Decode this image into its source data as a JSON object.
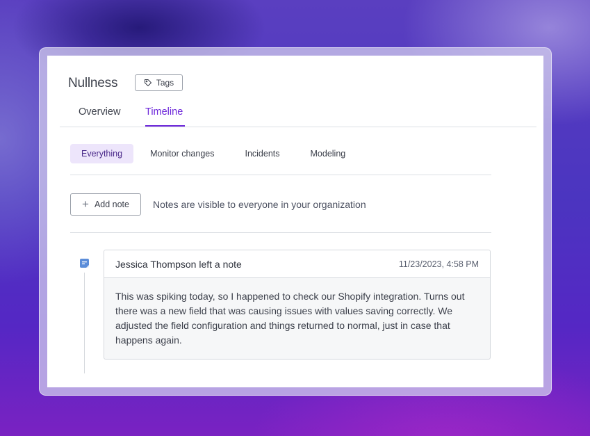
{
  "page": {
    "title": "Nullness",
    "tags_label": "Tags"
  },
  "tabs": [
    {
      "label": "Overview",
      "active": false
    },
    {
      "label": "Timeline",
      "active": true
    }
  ],
  "filters": [
    {
      "label": "Everything",
      "active": true
    },
    {
      "label": "Monitor changes",
      "active": false
    },
    {
      "label": "Incidents",
      "active": false
    },
    {
      "label": "Modeling",
      "active": false
    }
  ],
  "notes": {
    "add_label": "Add note",
    "hint": "Notes are visible to everyone in your organization"
  },
  "timeline": [
    {
      "icon": "note-icon",
      "author": "Jessica Thompson",
      "action": " left a note",
      "timestamp": "11/23/2023, 4:58 PM",
      "body": "This was spiking today, so I happened to check our Shopify integration. Turns out there was a new field that was causing issues with values saving correctly. We adjusted the field configuration and things returned to normal, just in case that happens again."
    }
  ],
  "colors": {
    "accent": "#6d28d9",
    "active_filter_bg": "#ede5fb",
    "note_icon": "#5b8dd9"
  }
}
